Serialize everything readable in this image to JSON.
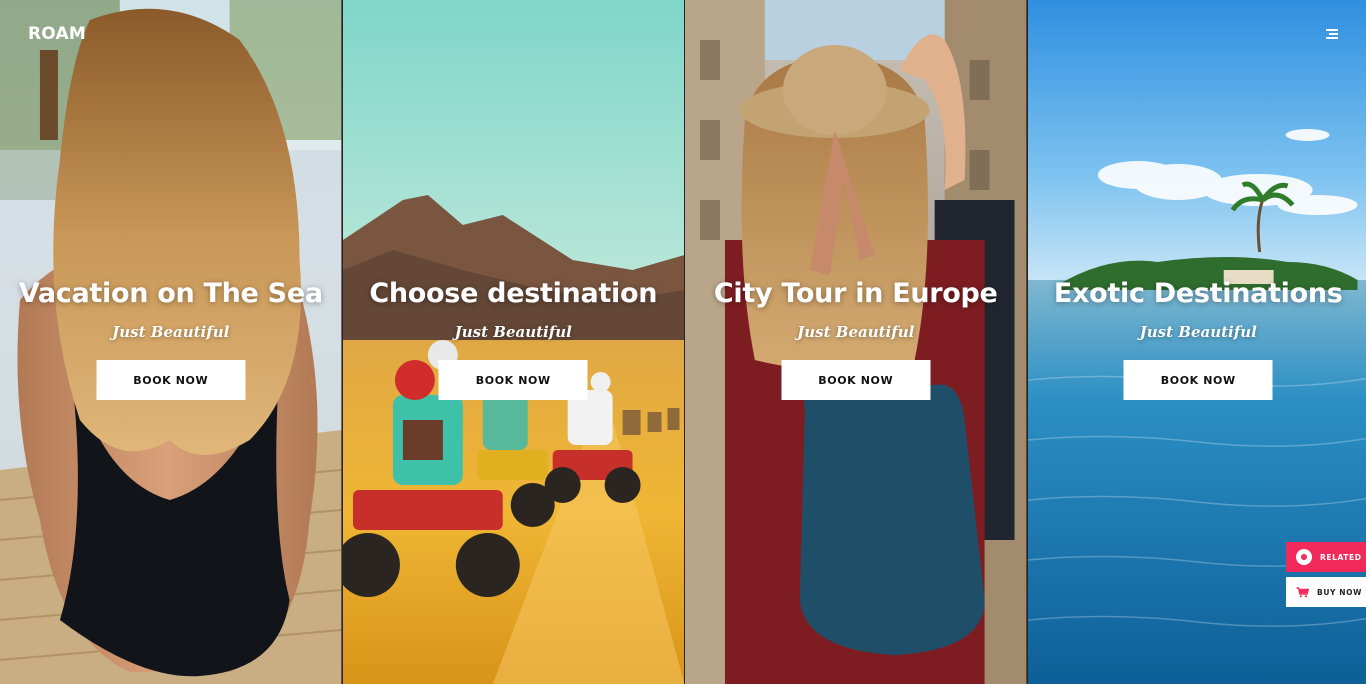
{
  "header": {
    "logo": "ROAM",
    "menu_icon": "hamburger-menu-icon"
  },
  "panels": [
    {
      "title": "Vacation on The Sea",
      "subtitle": "Just Beautiful",
      "button_label": "BOOK NOW"
    },
    {
      "title": "Choose destination",
      "subtitle": "Just Beautiful",
      "button_label": "BOOK NOW"
    },
    {
      "title": "City Tour in Europe",
      "subtitle": "Just Beautiful",
      "button_label": "BOOK NOW"
    },
    {
      "title": "Exotic Destinations",
      "subtitle": "Just Beautiful",
      "button_label": "BOOK NOW"
    }
  ],
  "side_buttons": {
    "related_label": "RELATED",
    "related_icon": "related-circle-icon",
    "buy_label": "BUY NOW",
    "buy_icon": "cart-icon"
  },
  "colors": {
    "accent": "#f2295b",
    "button_bg": "#ffffff",
    "text_on_image": "#ffffff"
  }
}
